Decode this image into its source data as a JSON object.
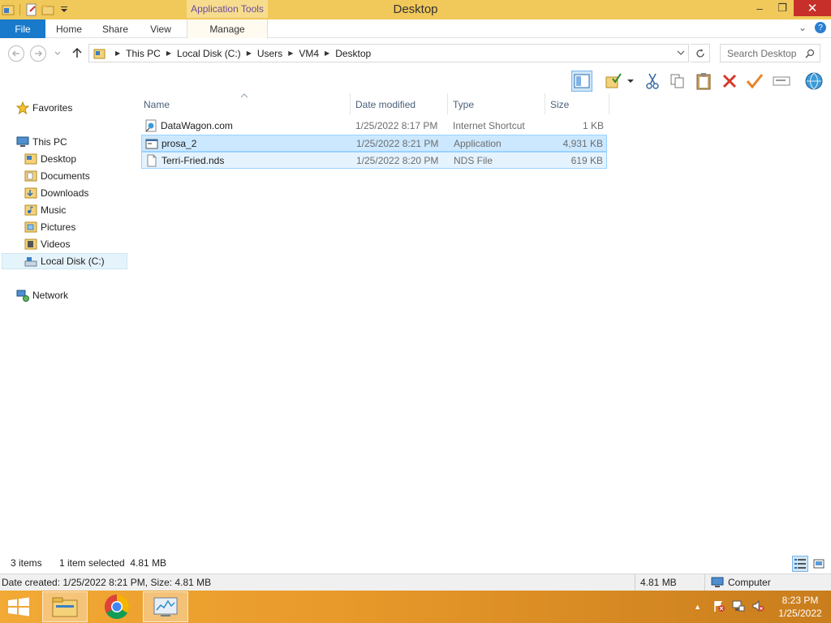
{
  "window": {
    "title": "Desktop",
    "contextual_tab_group": "Application Tools",
    "min_glyph": "–",
    "max_glyph": "❐",
    "close_glyph": "✕"
  },
  "ribbon": {
    "tabs": [
      "File",
      "Home",
      "Share",
      "View",
      "Manage"
    ],
    "expand_glyph": "⌄",
    "help_glyph": "?"
  },
  "address": {
    "breadcrumbs": [
      "This PC",
      "Local Disk (C:)",
      "Users",
      "VM4",
      "Desktop"
    ],
    "search_placeholder": "Search Desktop"
  },
  "nav": {
    "favorites": "Favorites",
    "this_pc": "This PC",
    "items": [
      "Desktop",
      "Documents",
      "Downloads",
      "Music",
      "Pictures",
      "Videos",
      "Local Disk (C:)"
    ],
    "network": "Network"
  },
  "columns": {
    "name": "Name",
    "date": "Date modified",
    "type": "Type",
    "size": "Size"
  },
  "files": [
    {
      "name": "DataWagon.com",
      "date": "1/25/2022 8:17 PM",
      "type": "Internet Shortcut",
      "size": "1 KB"
    },
    {
      "name": "prosa_2",
      "date": "1/25/2022 8:21 PM",
      "type": "Application",
      "size": "4,931 KB"
    },
    {
      "name": "Terri-Fried.nds",
      "date": "1/25/2022 8:20 PM",
      "type": "NDS File",
      "size": "619 KB"
    }
  ],
  "status": {
    "count": "3 items",
    "selection": "1 item selected  4.81 MB",
    "details": "Date created: 1/25/2022 8:21 PM, Size: 4.81 MB",
    "size": "4.81 MB",
    "location": "Computer"
  },
  "taskbar": {
    "time": "8:23 PM",
    "date": "1/25/2022",
    "tray_up_glyph": "▲"
  },
  "colors": {
    "title_bar": "#f1c85a",
    "file_tab": "#1979ca",
    "selection": "#cce8ff",
    "close_button": "#c7302a"
  }
}
